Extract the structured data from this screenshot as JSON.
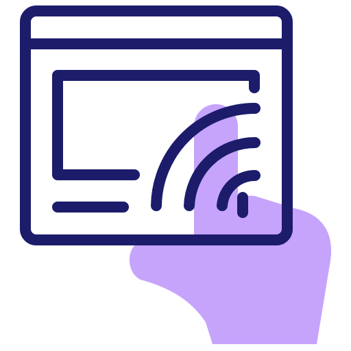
{
  "icon": {
    "name": "browser-window-cast-tap-icon",
    "colors": {
      "outline": "#1c1c6b",
      "hand": "#c6a4fb",
      "background": "#ffffff"
    }
  }
}
